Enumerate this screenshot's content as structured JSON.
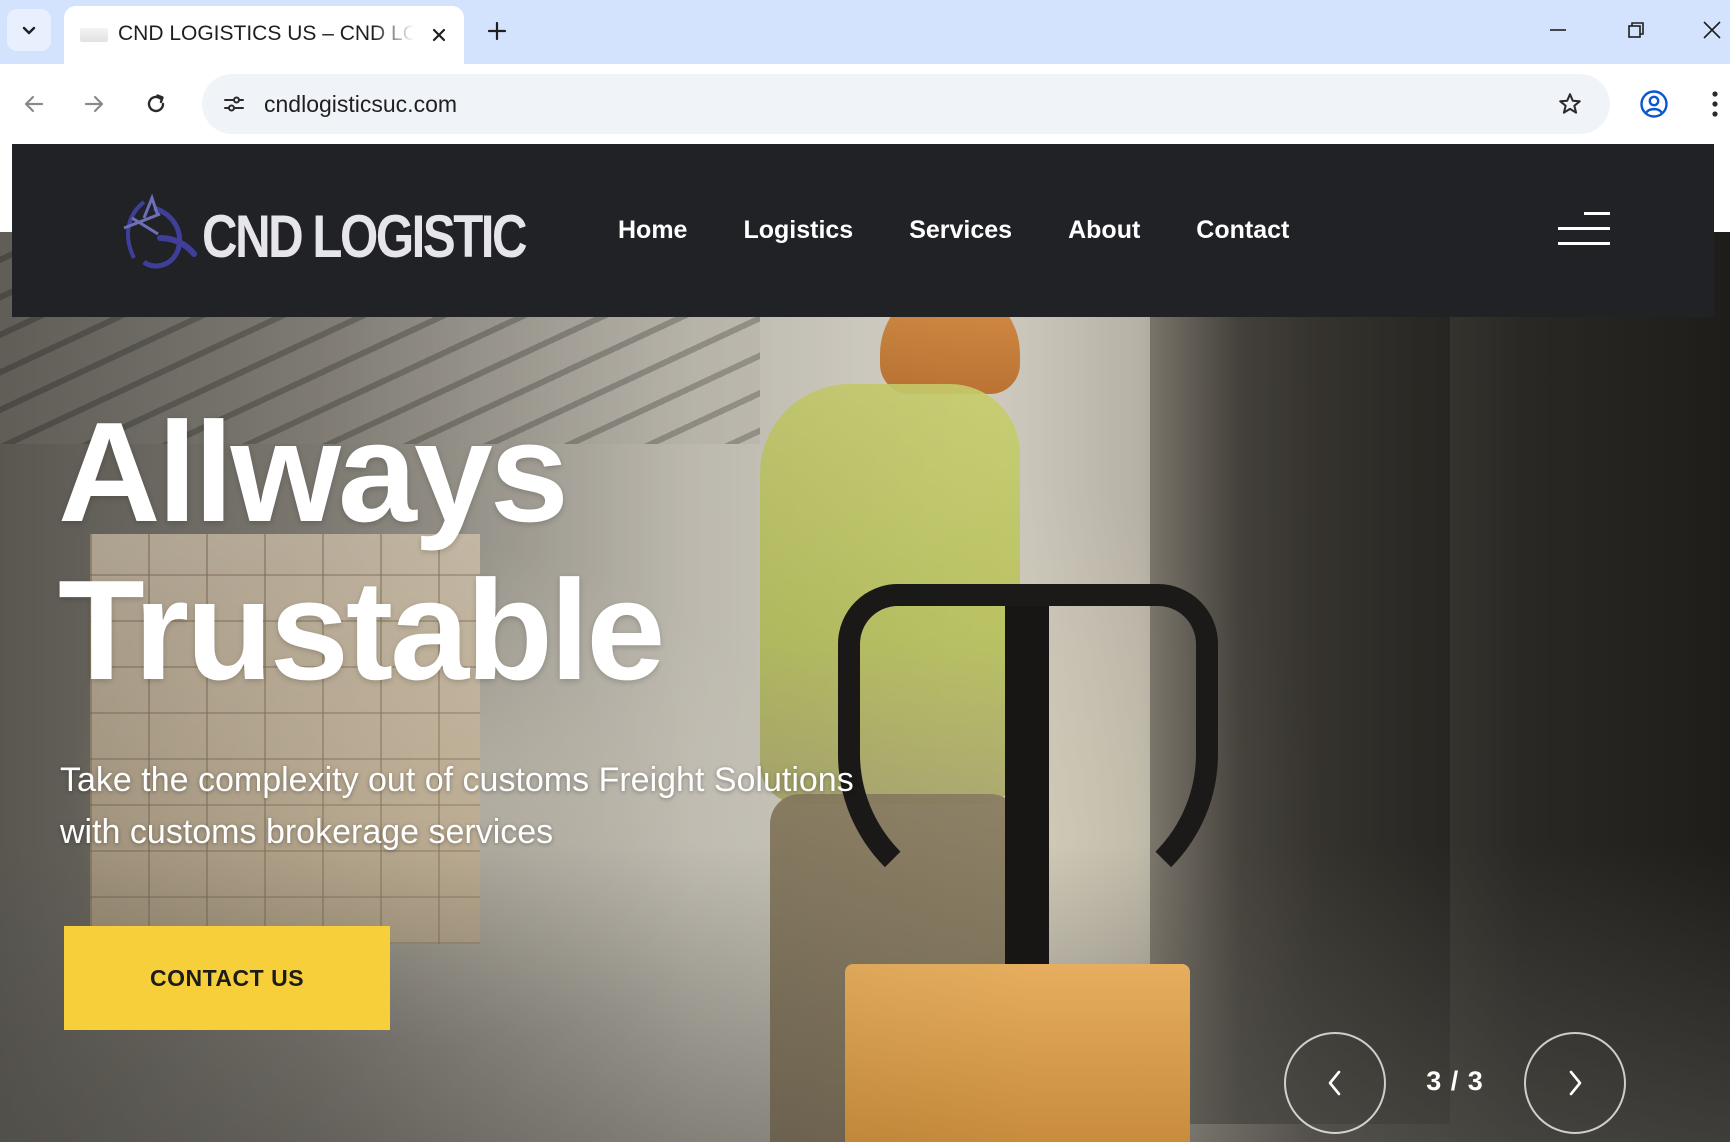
{
  "browser": {
    "tab_title": "CND LOGISTICS US – CND LOGISTICS",
    "url": "cndlogisticsuc.com"
  },
  "site": {
    "logo_text": "CND LOGISTIC",
    "nav": [
      "Home",
      "Logistics",
      "Services",
      "About",
      "Contact"
    ]
  },
  "hero": {
    "title_line1": "Allways",
    "title_line2": "Trustable",
    "subtitle_line1": "Take the complexity out of customs Freight Solutions",
    "subtitle_line2": "with customs brokerage services",
    "cta_label": "CONTACT US",
    "slide_counter": "3 / 3"
  },
  "colors": {
    "tabbar_bg": "#d3e3fd",
    "header_bg": "#212226",
    "cta_bg": "#f7cf3a",
    "logo_mark": "#3f3f9a"
  },
  "icons": {
    "tab_list": "chevron-down-icon",
    "tab_close": "close-icon",
    "new_tab": "plus-icon",
    "back": "arrow-left-icon",
    "forward": "arrow-right-icon",
    "reload": "reload-icon",
    "site_info": "tune-icon",
    "bookmark": "star-icon",
    "profile": "account-circle-icon",
    "menu": "kebab-icon",
    "hamburger": "hamburger-icon",
    "prev": "chevron-left-icon",
    "next": "chevron-right-icon"
  }
}
